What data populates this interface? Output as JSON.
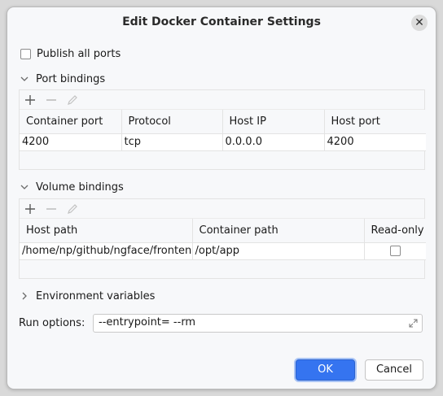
{
  "dialog": {
    "title": "Edit Docker Container Settings"
  },
  "publish_all_ports": {
    "label": "Publish all ports",
    "checked": false
  },
  "port_bindings": {
    "header": "Port bindings",
    "toolbar": [
      "add-icon",
      "remove-icon",
      "edit-icon"
    ],
    "columns": [
      "Container port",
      "Protocol",
      "Host IP",
      "Host port"
    ],
    "rows": [
      [
        "4200",
        "tcp",
        "0.0.0.0",
        "4200"
      ]
    ]
  },
  "volume_bindings": {
    "header": "Volume bindings",
    "toolbar": [
      "add-icon",
      "remove-icon",
      "edit-icon"
    ],
    "columns": [
      "Host path",
      "Container path",
      "Read-only"
    ],
    "rows": [
      {
        "host_path": "/home/np/github/ngface/frontend",
        "container_path": "/opt/app",
        "read_only": false
      }
    ]
  },
  "environment_variables": {
    "header": "Environment variables",
    "expanded": false
  },
  "run_options": {
    "label": "Run options:",
    "value": "--entrypoint= --rm"
  },
  "buttons": {
    "ok": "OK",
    "cancel": "Cancel"
  },
  "colors": {
    "accent": "#3574f0"
  }
}
